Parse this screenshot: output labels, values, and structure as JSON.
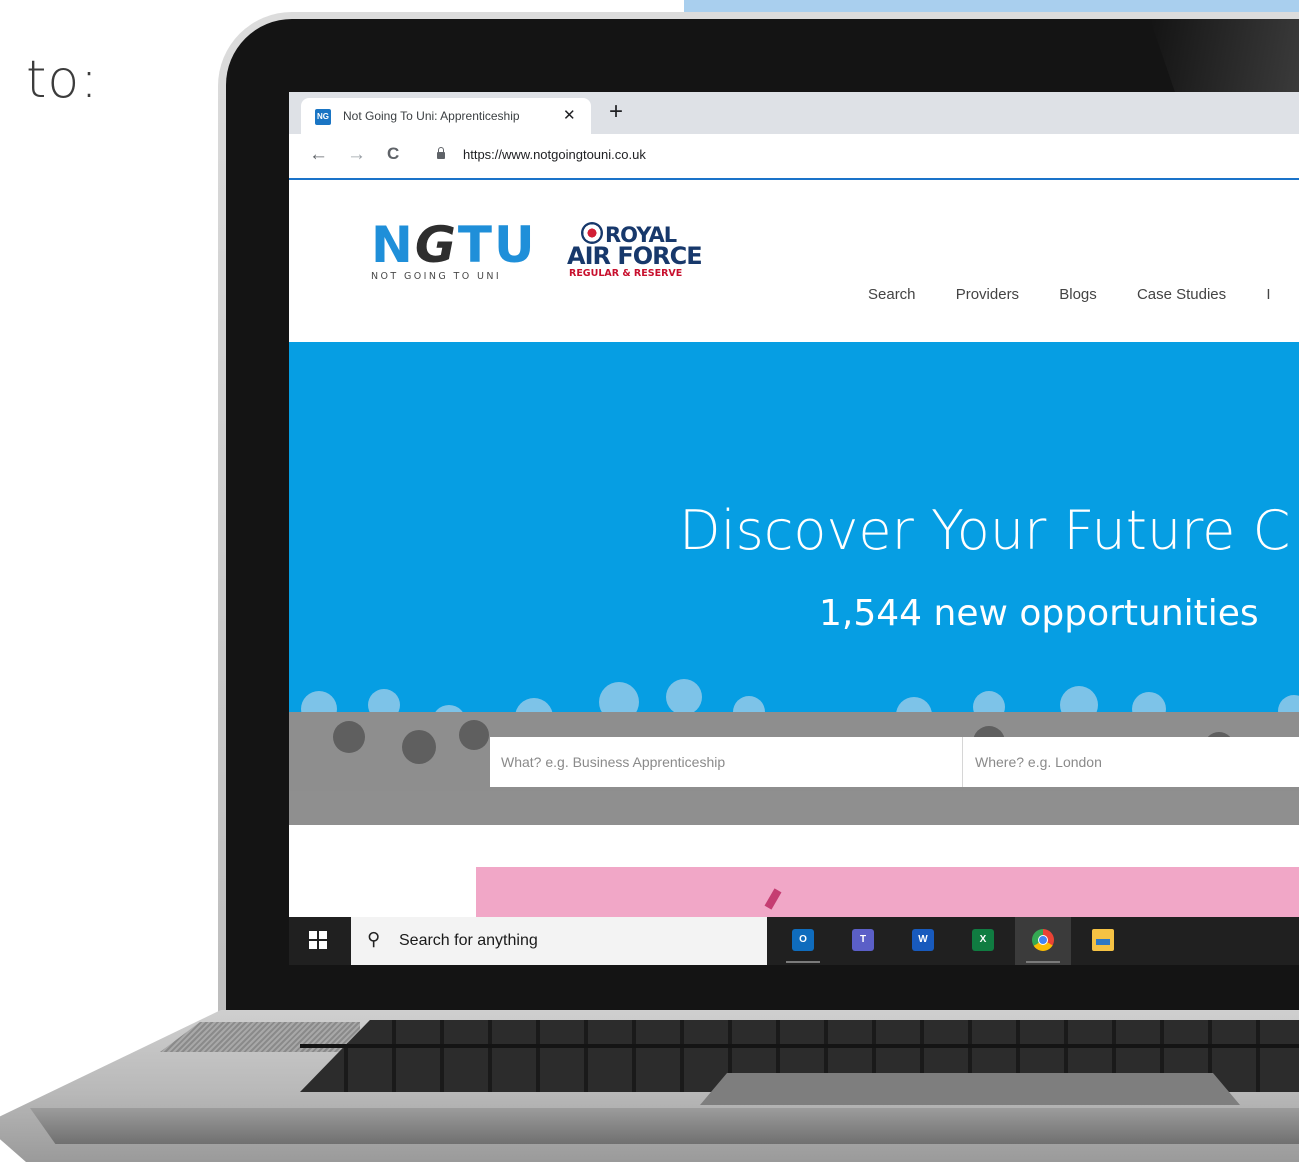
{
  "intro_text": "to:",
  "browser": {
    "tab_title": "Not Going To Uni: Apprenticeship",
    "tab_close": "✕",
    "new_tab": "+",
    "back": "←",
    "forward": "→",
    "reload": "C",
    "url": "https://www.notgoingtouni.co.uk",
    "favicon_text": "NG"
  },
  "site": {
    "logo_ngtu": {
      "n": "N",
      "g": "G",
      "tu": "TU",
      "tagline": "NOT GOING TO UNI"
    },
    "logo_raf": {
      "line1": "ROYAL",
      "line2": "AIR FORCE",
      "line3": "REGULAR & RESERVE"
    },
    "nav": [
      "Search",
      "Providers",
      "Blogs",
      "Case Studies",
      "I"
    ],
    "hero_title": "Discover Your Future C",
    "hero_subtitle": "1,544 new opportunities",
    "search_what_placeholder": "What? e.g. Business Apprenticeship",
    "search_where_placeholder": "Where? e.g. London"
  },
  "taskbar": {
    "search_placeholder": "Search for anything",
    "search_icon": "⚲",
    "apps": [
      {
        "name": "outlook",
        "label": "O",
        "color": "#0f6cbd"
      },
      {
        "name": "teams",
        "label": "T",
        "color": "#5b5fc7"
      },
      {
        "name": "word",
        "label": "W",
        "color": "#185abd"
      },
      {
        "name": "excel",
        "label": "X",
        "color": "#107c41"
      },
      {
        "name": "chrome",
        "label": "",
        "color": "#ea4335"
      },
      {
        "name": "file-explorer",
        "label": "",
        "color": "#f5c244"
      }
    ]
  }
}
